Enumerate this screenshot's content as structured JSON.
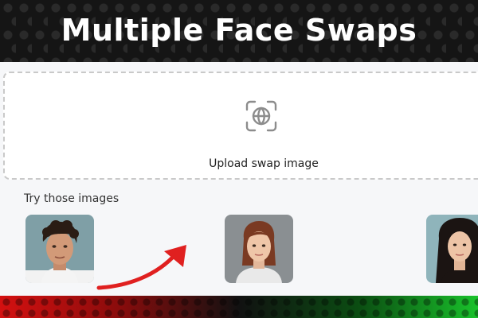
{
  "banner": {
    "title": "Multiple Face Swaps"
  },
  "upload": {
    "label": "Upload swap image",
    "icon": "face-scan-icon"
  },
  "samples": {
    "label": "Try those images",
    "images": [
      {
        "name": "sample-face-man-curly"
      },
      {
        "name": "sample-face-woman-auburn"
      },
      {
        "name": "sample-face-woman-dark-hair"
      }
    ]
  },
  "colors": {
    "arrow": "#e02020",
    "banner_bg": "#151515",
    "app_bg": "#f6f7f9",
    "strip_left": "#d41010",
    "strip_right": "#19c22b"
  }
}
